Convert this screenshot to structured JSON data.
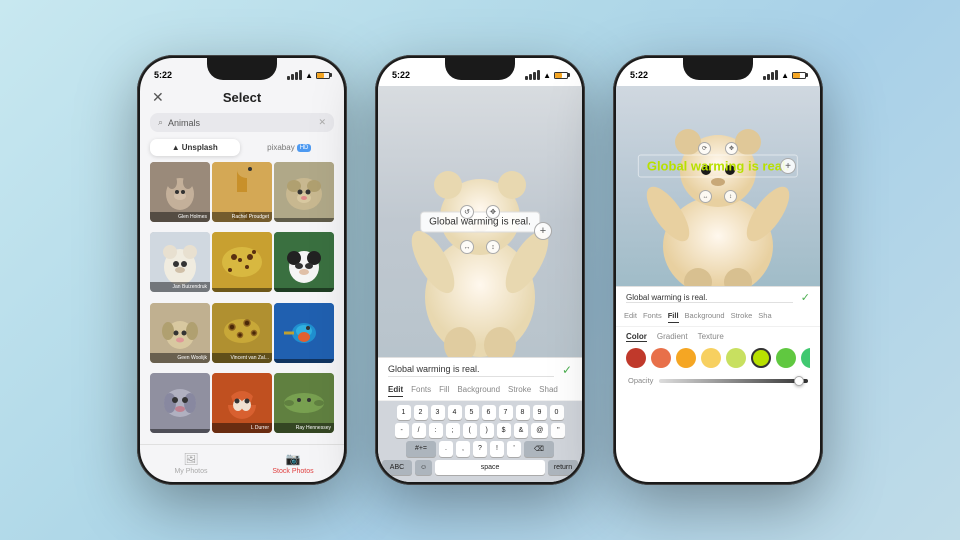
{
  "background": {
    "gradient_start": "#c8e8f0",
    "gradient_end": "#c0dce8"
  },
  "phone1": {
    "status_time": "5:22",
    "header_title": "Select",
    "search_placeholder": "Animals",
    "tab_unsplash": "Unsplash",
    "tab_pixabay": "pixabay",
    "photos": [
      {
        "label": "Glen Holmes",
        "bg": "cat"
      },
      {
        "label": "Rachel Proudget",
        "bg": "giraffe"
      },
      {
        "label": "",
        "bg": "dog"
      },
      {
        "label": "Jan Buizendruk",
        "bg": "bear"
      },
      {
        "label": "",
        "bg": "cheetah"
      },
      {
        "label": "",
        "bg": "panda"
      },
      {
        "label": "Geen Woolijk",
        "bg": "puppy"
      },
      {
        "label": "Vincent van Zal...",
        "bg": "leopard"
      },
      {
        "label": "",
        "bg": "kingfisher"
      },
      {
        "label": "",
        "bg": "hound"
      },
      {
        "label": "L Durrer",
        "bg": "fox"
      },
      {
        "label": "Ray Hennessey",
        "bg": "lizard"
      }
    ],
    "bottom_my_photos": "My Photos",
    "bottom_stock_photos": "Stock Photos"
  },
  "phone2": {
    "text_overlay": "Global warming is real.",
    "text_input_value": "Global warming is real.",
    "tabs": [
      "Edit",
      "Fonts",
      "Fill",
      "Background",
      "Stroke",
      "Shad"
    ],
    "active_tab": "Edit",
    "keyboard": {
      "row1": [
        "1",
        "2",
        "3",
        "4",
        "5",
        "6",
        "7",
        "8",
        "9",
        "0"
      ],
      "row2": [
        "-",
        "/",
        ":",
        ";",
        "(",
        ")",
        "$",
        "&",
        "@",
        "\""
      ],
      "row3": [
        "#+",
        ".",
        ",",
        "?",
        "!",
        "'",
        "⌫"
      ],
      "row4_abc": "ABC",
      "row4_emoji": "☺",
      "row4_space": "space",
      "row4_return": "return"
    }
  },
  "phone3": {
    "text_overlay": "Global warming is real.",
    "text_input_value": "Global warming is real.",
    "tabs": [
      "Edit",
      "Fonts",
      "Fill",
      "Background",
      "Stroke",
      "Sha"
    ],
    "active_tab": "Fill",
    "color_tabs": [
      "Color",
      "Gradient",
      "Texture"
    ],
    "active_color_tab": "Color",
    "colors": [
      {
        "hex": "#c0392b",
        "selected": false
      },
      {
        "hex": "#e8704a",
        "selected": false
      },
      {
        "hex": "#f5a623",
        "selected": false
      },
      {
        "hex": "#f7d060",
        "selected": false
      },
      {
        "hex": "#c8e060",
        "selected": false
      },
      {
        "hex": "#b8e000",
        "selected": true
      },
      {
        "hex": "#60c840",
        "selected": false
      },
      {
        "hex": "#40c870",
        "selected": false
      },
      {
        "hex": "#30b890",
        "selected": false
      }
    ],
    "opacity_label": "Opacity",
    "opacity_value": 95
  }
}
